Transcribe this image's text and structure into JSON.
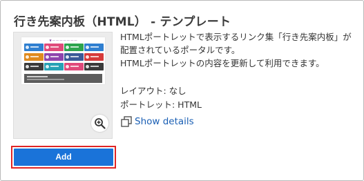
{
  "template": {
    "title": "行き先案内板（HTML） - テンプレート",
    "description": [
      "HTMLポートレットで表示するリンク集「行き先案内板」が",
      "配置されているポータルです。",
      "HTMLポートレットの内容を更新して利用できます。"
    ],
    "layout_line": "レイアウト: なし",
    "portlet_line": "ポートレット: HTML",
    "show_details_label": "Show details",
    "add_label": "Add"
  },
  "thumbnail": {
    "tile_colors": [
      "#2f7fd0",
      "#e0497a",
      "#2da44e",
      "#2f7fd0",
      "#e08a1e",
      "#8e44ad",
      "#3b5998",
      "#d63a3a",
      "#3b3b3b",
      "#27a2b5",
      "#e0497a",
      "#3b3b3b"
    ]
  },
  "icons": {
    "zoom": "zoom-in-icon",
    "details": "overlapping-squares-icon"
  },
  "colors": {
    "accent": "#1a73d9",
    "highlight_border": "#e02424",
    "link": "#1a5fb4"
  }
}
